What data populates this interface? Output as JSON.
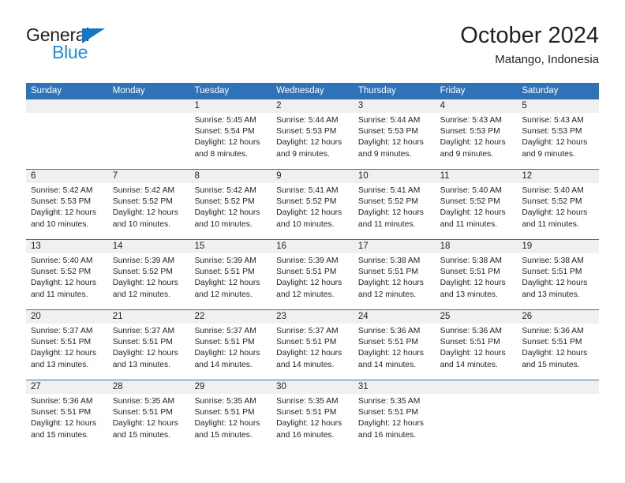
{
  "brand": {
    "name_part1": "General",
    "name_part2": "Blue",
    "triangle_icon": "triangle-icon",
    "accent_color": "#1e8ce0",
    "triangle_color": "#1476c6"
  },
  "header": {
    "title": "October 2024",
    "subtitle": "Matango, Indonesia"
  },
  "theme": {
    "header_blue": "#2e72b8",
    "daynum_band": "#f0f0f0",
    "text": "#231f20"
  },
  "labels": {
    "sunrise_prefix": "Sunrise:",
    "sunset_prefix": "Sunset:",
    "daylight_prefix": "Daylight:"
  },
  "weekdays": [
    "Sunday",
    "Monday",
    "Tuesday",
    "Wednesday",
    "Thursday",
    "Friday",
    "Saturday"
  ],
  "weeks": [
    [
      {
        "day": "",
        "empty": true
      },
      {
        "day": "",
        "empty": true
      },
      {
        "day": "1",
        "sunrise": "Sunrise: 5:45 AM",
        "sunset": "Sunset: 5:54 PM",
        "daylight": "Daylight: 12 hours and 8 minutes."
      },
      {
        "day": "2",
        "sunrise": "Sunrise: 5:44 AM",
        "sunset": "Sunset: 5:53 PM",
        "daylight": "Daylight: 12 hours and 9 minutes."
      },
      {
        "day": "3",
        "sunrise": "Sunrise: 5:44 AM",
        "sunset": "Sunset: 5:53 PM",
        "daylight": "Daylight: 12 hours and 9 minutes."
      },
      {
        "day": "4",
        "sunrise": "Sunrise: 5:43 AM",
        "sunset": "Sunset: 5:53 PM",
        "daylight": "Daylight: 12 hours and 9 minutes."
      },
      {
        "day": "5",
        "sunrise": "Sunrise: 5:43 AM",
        "sunset": "Sunset: 5:53 PM",
        "daylight": "Daylight: 12 hours and 9 minutes."
      }
    ],
    [
      {
        "day": "6",
        "sunrise": "Sunrise: 5:42 AM",
        "sunset": "Sunset: 5:53 PM",
        "daylight": "Daylight: 12 hours and 10 minutes."
      },
      {
        "day": "7",
        "sunrise": "Sunrise: 5:42 AM",
        "sunset": "Sunset: 5:52 PM",
        "daylight": "Daylight: 12 hours and 10 minutes."
      },
      {
        "day": "8",
        "sunrise": "Sunrise: 5:42 AM",
        "sunset": "Sunset: 5:52 PM",
        "daylight": "Daylight: 12 hours and 10 minutes."
      },
      {
        "day": "9",
        "sunrise": "Sunrise: 5:41 AM",
        "sunset": "Sunset: 5:52 PM",
        "daylight": "Daylight: 12 hours and 10 minutes."
      },
      {
        "day": "10",
        "sunrise": "Sunrise: 5:41 AM",
        "sunset": "Sunset: 5:52 PM",
        "daylight": "Daylight: 12 hours and 11 minutes."
      },
      {
        "day": "11",
        "sunrise": "Sunrise: 5:40 AM",
        "sunset": "Sunset: 5:52 PM",
        "daylight": "Daylight: 12 hours and 11 minutes."
      },
      {
        "day": "12",
        "sunrise": "Sunrise: 5:40 AM",
        "sunset": "Sunset: 5:52 PM",
        "daylight": "Daylight: 12 hours and 11 minutes."
      }
    ],
    [
      {
        "day": "13",
        "sunrise": "Sunrise: 5:40 AM",
        "sunset": "Sunset: 5:52 PM",
        "daylight": "Daylight: 12 hours and 11 minutes."
      },
      {
        "day": "14",
        "sunrise": "Sunrise: 5:39 AM",
        "sunset": "Sunset: 5:52 PM",
        "daylight": "Daylight: 12 hours and 12 minutes."
      },
      {
        "day": "15",
        "sunrise": "Sunrise: 5:39 AM",
        "sunset": "Sunset: 5:51 PM",
        "daylight": "Daylight: 12 hours and 12 minutes."
      },
      {
        "day": "16",
        "sunrise": "Sunrise: 5:39 AM",
        "sunset": "Sunset: 5:51 PM",
        "daylight": "Daylight: 12 hours and 12 minutes."
      },
      {
        "day": "17",
        "sunrise": "Sunrise: 5:38 AM",
        "sunset": "Sunset: 5:51 PM",
        "daylight": "Daylight: 12 hours and 12 minutes."
      },
      {
        "day": "18",
        "sunrise": "Sunrise: 5:38 AM",
        "sunset": "Sunset: 5:51 PM",
        "daylight": "Daylight: 12 hours and 13 minutes."
      },
      {
        "day": "19",
        "sunrise": "Sunrise: 5:38 AM",
        "sunset": "Sunset: 5:51 PM",
        "daylight": "Daylight: 12 hours and 13 minutes."
      }
    ],
    [
      {
        "day": "20",
        "sunrise": "Sunrise: 5:37 AM",
        "sunset": "Sunset: 5:51 PM",
        "daylight": "Daylight: 12 hours and 13 minutes."
      },
      {
        "day": "21",
        "sunrise": "Sunrise: 5:37 AM",
        "sunset": "Sunset: 5:51 PM",
        "daylight": "Daylight: 12 hours and 13 minutes."
      },
      {
        "day": "22",
        "sunrise": "Sunrise: 5:37 AM",
        "sunset": "Sunset: 5:51 PM",
        "daylight": "Daylight: 12 hours and 14 minutes."
      },
      {
        "day": "23",
        "sunrise": "Sunrise: 5:37 AM",
        "sunset": "Sunset: 5:51 PM",
        "daylight": "Daylight: 12 hours and 14 minutes."
      },
      {
        "day": "24",
        "sunrise": "Sunrise: 5:36 AM",
        "sunset": "Sunset: 5:51 PM",
        "daylight": "Daylight: 12 hours and 14 minutes."
      },
      {
        "day": "25",
        "sunrise": "Sunrise: 5:36 AM",
        "sunset": "Sunset: 5:51 PM",
        "daylight": "Daylight: 12 hours and 14 minutes."
      },
      {
        "day": "26",
        "sunrise": "Sunrise: 5:36 AM",
        "sunset": "Sunset: 5:51 PM",
        "daylight": "Daylight: 12 hours and 15 minutes."
      }
    ],
    [
      {
        "day": "27",
        "sunrise": "Sunrise: 5:36 AM",
        "sunset": "Sunset: 5:51 PM",
        "daylight": "Daylight: 12 hours and 15 minutes."
      },
      {
        "day": "28",
        "sunrise": "Sunrise: 5:35 AM",
        "sunset": "Sunset: 5:51 PM",
        "daylight": "Daylight: 12 hours and 15 minutes."
      },
      {
        "day": "29",
        "sunrise": "Sunrise: 5:35 AM",
        "sunset": "Sunset: 5:51 PM",
        "daylight": "Daylight: 12 hours and 15 minutes."
      },
      {
        "day": "30",
        "sunrise": "Sunrise: 5:35 AM",
        "sunset": "Sunset: 5:51 PM",
        "daylight": "Daylight: 12 hours and 16 minutes."
      },
      {
        "day": "31",
        "sunrise": "Sunrise: 5:35 AM",
        "sunset": "Sunset: 5:51 PM",
        "daylight": "Daylight: 12 hours and 16 minutes."
      },
      {
        "day": "",
        "empty": true
      },
      {
        "day": "",
        "empty": true
      }
    ]
  ]
}
